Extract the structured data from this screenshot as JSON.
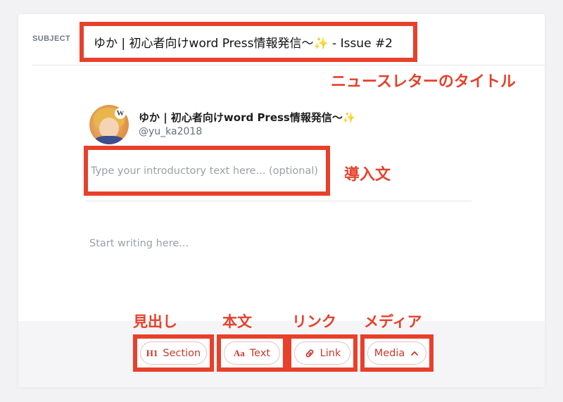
{
  "subject": {
    "label": "SUBJECT",
    "value": "ゆか | 初心者向けword Press情報発信〜✨ - Issue #2"
  },
  "annotations": {
    "title": "ニュースレターのタイトル",
    "intro": "導入文",
    "heading": "見出し",
    "body_text": "本文",
    "link": "リンク",
    "media": "メディア"
  },
  "sender": {
    "name": "ゆか | 初心者向けword Press情報発信〜✨",
    "handle": "@yu_ka2018"
  },
  "intro": {
    "placeholder": "Type your introductory text here... (optional)"
  },
  "body": {
    "placeholder": "Start writing here..."
  },
  "toolbar": {
    "section": {
      "icon_text": "H1",
      "label": "Section"
    },
    "text": {
      "icon_text": "Aa",
      "label": "Text"
    },
    "link": {
      "label": "Link"
    },
    "media": {
      "label": "Media"
    }
  },
  "colors": {
    "annotation_red": "#e8402a",
    "button_text": "#c83a2e"
  },
  "icons": {
    "link": "link-icon",
    "media": "chevron-up-icon"
  }
}
